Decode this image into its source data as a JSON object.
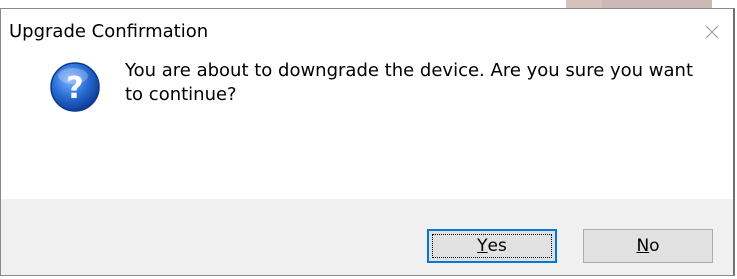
{
  "dialog": {
    "title": "Upgrade Confirmation",
    "close_icon": "close-icon",
    "message": "You are about to downgrade the device. Are you sure you want to continue?",
    "icon": "question-icon"
  },
  "buttons": {
    "yes": {
      "mnemonic": "Y",
      "rest": "es"
    },
    "no": {
      "mnemonic": "N",
      "rest": "o"
    }
  },
  "colors": {
    "footer_bg": "#f0f0f0",
    "accent": "#0078d7",
    "icon_blue": "#1f5fbf"
  }
}
